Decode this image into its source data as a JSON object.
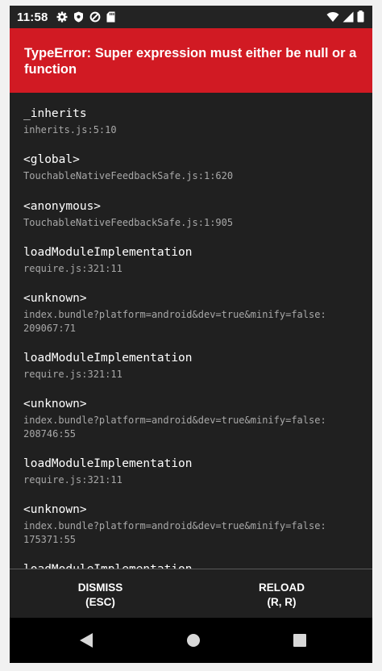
{
  "status_bar": {
    "time": "11:58",
    "left_icons": [
      "settings-icon",
      "shield-icon",
      "data-saver-icon",
      "sd-card-icon"
    ],
    "right_icons": [
      "wifi-icon",
      "cell-signal-icon",
      "battery-icon"
    ]
  },
  "error": {
    "title": "TypeError: Super expression must either be null or a function",
    "background_color": "#d11a23"
  },
  "stack_frames": [
    {
      "fn": "_inherits",
      "loc": "inherits.js:5:10"
    },
    {
      "fn": "<global>",
      "loc": "TouchableNativeFeedbackSafe.js:1:620"
    },
    {
      "fn": "<anonymous>",
      "loc": "TouchableNativeFeedbackSafe.js:1:905"
    },
    {
      "fn": "loadModuleImplementation",
      "loc": "require.js:321:11"
    },
    {
      "fn": "<unknown>",
      "loc": "index.bundle?platform=android&dev=true&minify=false:\n209067:71"
    },
    {
      "fn": "loadModuleImplementation",
      "loc": "require.js:321:11"
    },
    {
      "fn": "<unknown>",
      "loc": "index.bundle?platform=android&dev=true&minify=false:\n208746:55"
    },
    {
      "fn": "loadModuleImplementation",
      "loc": "require.js:321:11"
    },
    {
      "fn": "<unknown>",
      "loc": "index.bundle?platform=android&dev=true&minify=false:\n175371:55"
    },
    {
      "fn": "loadModuleImplementation",
      "loc": ""
    }
  ],
  "footer": {
    "dismiss": {
      "line1": "DISMISS",
      "line2": "(ESC)"
    },
    "reload": {
      "line1": "RELOAD",
      "line2": "(R, R)"
    }
  },
  "nav_bar": {
    "icons": [
      "back-icon",
      "home-icon",
      "recents-icon"
    ]
  }
}
